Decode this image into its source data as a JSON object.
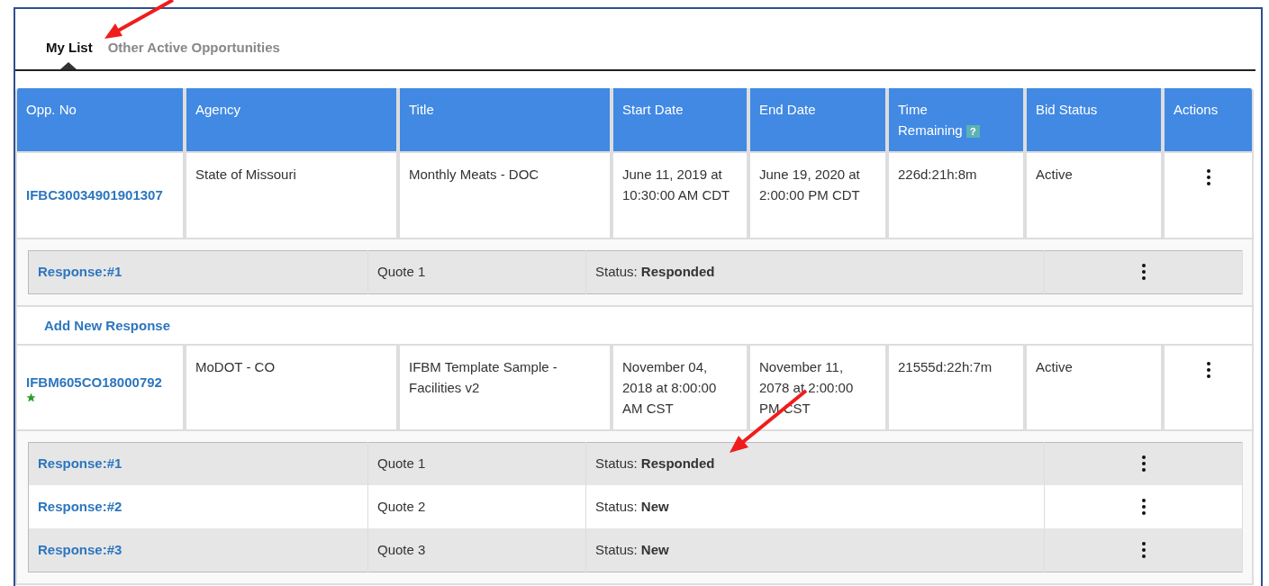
{
  "tabs": [
    {
      "label": "My List",
      "selected": true
    },
    {
      "label": "Other Active Opportunities",
      "selected": false
    }
  ],
  "table": {
    "columns": [
      {
        "label": "Opp. No"
      },
      {
        "label": "Agency"
      },
      {
        "label": "Title"
      },
      {
        "label": "Start Date"
      },
      {
        "label": "End Date"
      },
      {
        "label": "Time Remaining",
        "help": "?"
      },
      {
        "label": "Bid Status"
      },
      {
        "label": "Actions"
      }
    ],
    "rows": [
      {
        "opp_no": "IFBC30034901901307",
        "starred": false,
        "agency": "State of Missouri",
        "title": "Monthly Meats - DOC",
        "start_date": "June 11, 2019 at 10:30:00 AM CDT",
        "end_date": "June 19, 2020 at 2:00:00 PM CDT",
        "time_remaining": "226d:21h:8m",
        "bid_status": "Active",
        "responses": [
          {
            "label": "Response:#1",
            "quote": "Quote 1",
            "status_label": "Status:",
            "status": "Responded"
          }
        ],
        "add_response": "Add New Response"
      },
      {
        "opp_no": "IFBM605CO18000792",
        "starred": true,
        "agency": "MoDOT - CO",
        "title": "IFBM Template Sample - Facilities v2",
        "start_date": "November 04, 2018 at 8:00:00 AM CST",
        "end_date": "November 11, 2078 at 2:00:00 PM CST",
        "time_remaining": "21555d:22h:7m",
        "bid_status": "Active",
        "responses": [
          {
            "label": "Response:#1",
            "quote": "Quote 1",
            "status_label": "Status:",
            "status": "Responded"
          },
          {
            "label": "Response:#2",
            "quote": "Quote 2",
            "status_label": "Status:",
            "status": "New"
          },
          {
            "label": "Response:#3",
            "quote": "Quote 3",
            "status_label": "Status:",
            "status": "New"
          }
        ]
      }
    ]
  }
}
